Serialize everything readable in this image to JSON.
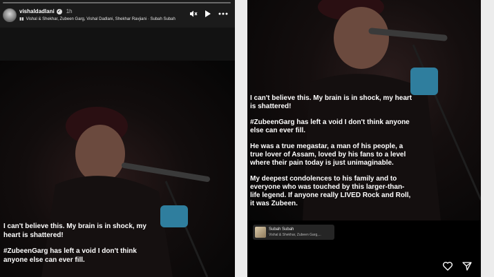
{
  "story": {
    "username": "vishaldadlani",
    "time_ago": "1h",
    "music_line": "Vishal & Shekhar, Zubeen Garg, Vishal Dadlani, Shekhar Ravjiani · Subah Subah",
    "controls": {
      "mute_icon": "speaker-muted-icon",
      "play_icon": "play-icon",
      "more_icon": "more-icon"
    },
    "caption": [
      "I can't believe this. My brain is in shock, my heart is shattered!",
      "#ZubeenGarg has left a void I don't think anyone else can ever fill."
    ]
  },
  "post": {
    "paragraphs": [
      "I can't believe this. My brain is in shock, my heart is shattered!",
      "#ZubeenGarg has left a void I don't think anyone else can ever fill.",
      "He was a true megastar, a man of his people, a true lover of Assam, loved by his fans to a level where their pain today is just unimaginable.",
      "My deepest condolences to his family and to everyone who was touched by this larger-than-life legend. If anyone really LIVED Rock and Roll, it was Zubeen."
    ],
    "music_sticker": {
      "title": "Subah Subah",
      "artists": "Vishal & Shekhar, Zubeen Garg,..."
    },
    "actions": {
      "like_icon": "heart-icon",
      "share_icon": "send-icon"
    }
  },
  "colors": {
    "panel_bg": "#000000",
    "header_bg": "#1b1b1b",
    "text": "#ffffff",
    "page_bg": "#ececec"
  }
}
